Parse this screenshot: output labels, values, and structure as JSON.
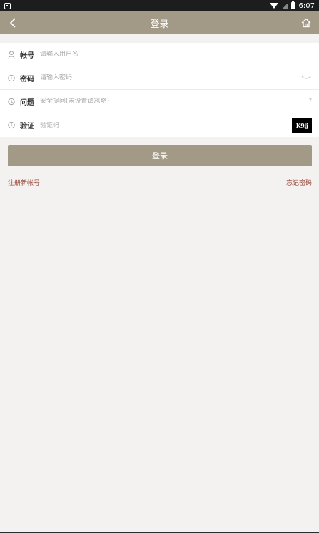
{
  "status_bar": {
    "time": "6:07"
  },
  "header": {
    "title": "登录"
  },
  "form": {
    "account": {
      "label": "帐号",
      "placeholder": "请输入用户名"
    },
    "password": {
      "label": "密码",
      "placeholder": "请输入密码"
    },
    "question": {
      "label": "问题",
      "placeholder": "安全提问(未设置请忽略)",
      "hint": "?"
    },
    "captcha": {
      "label": "验证",
      "placeholder": "验证码",
      "captcha_text": "K9lj"
    }
  },
  "login_button": {
    "label": "登录"
  },
  "links": {
    "register": "注册新帐号",
    "forgot": "忘记密码"
  },
  "colors": {
    "header_bg": "#a29a87",
    "link": "#9a4a3a",
    "background": "#f3f2f1"
  },
  "icons": {
    "back": "chevron-left-icon",
    "home": "home-icon",
    "account": "user-icon",
    "password": "lock-icon",
    "question": "question-icon",
    "captcha": "shield-icon",
    "eye": "eye-closed-icon"
  }
}
